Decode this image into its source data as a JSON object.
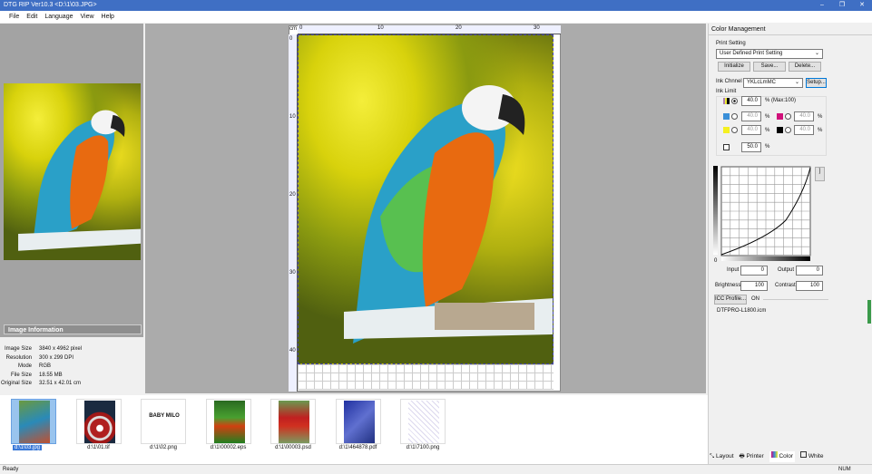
{
  "window": {
    "title": "DTG RIP Ver10.3  <D:\\1\\03.JPG>",
    "controls": [
      "–",
      "❐",
      "✕"
    ]
  },
  "menu": [
    "File",
    "Edit",
    "Language",
    "View",
    "Help"
  ],
  "image_info": {
    "title": "Image Information",
    "rows": [
      {
        "k": "Image Size",
        "v": "3840 x 4962 pixel"
      },
      {
        "k": "Resolution",
        "v": "300 x 299 DPI"
      },
      {
        "k": "Mode",
        "v": "RGB"
      },
      {
        "k": "File Size",
        "v": "18.55 MB"
      },
      {
        "k": "Original Size",
        "v": "32.51 x 42.01 cm"
      }
    ]
  },
  "ruler": {
    "unit": "cm",
    "top_ticks": [
      "0",
      "10",
      "20",
      "30"
    ],
    "left_ticks": [
      "0",
      "10",
      "20",
      "30",
      "40"
    ]
  },
  "color_mgmt": {
    "title": "Color Management",
    "print_setting_label": "Print Setting",
    "print_setting_value": "User Defined Print Setting",
    "initialize": "Initialize",
    "save": "Save...",
    "delete": "Delete...",
    "ink_channel_label": "Ink Chnnel",
    "ink_channel_value": "YKLcLmMC",
    "setup": "Setup...",
    "ink_limit_label": "Ink Limit",
    "all_value": "40.0",
    "max_text": "% (Max:100)",
    "cyan": "40.0",
    "magenta": "40.0",
    "yellow": "40.0",
    "black": "40.0",
    "white": "50.0",
    "pct": "%",
    "curve_origin": "0",
    "input_label": "Input",
    "input": "0",
    "output_label": "Output",
    "output": "0",
    "brightness_label": "Brightness",
    "brightness": "100",
    "contrast_label": "Contrast",
    "contrast": "100",
    "icc_button": "ICC Profile...",
    "icc_state": "ON",
    "icc_file": "DTFPRO-L1800.icm",
    "colors": {
      "cyan": "#3a8fd8",
      "magenta": "#d0107a",
      "yellow": "#f5f020",
      "black": "#000000"
    }
  },
  "tabs": [
    "Layout",
    "Printer",
    "Color",
    "White"
  ],
  "thumbnails": [
    {
      "label": "d:\\1\\03.jpg",
      "selected": true
    },
    {
      "label": "d:\\1\\01.tif"
    },
    {
      "label": "d:\\1\\02.png"
    },
    {
      "label": "d:\\1\\00002.eps"
    },
    {
      "label": "d:\\1\\00003.psd"
    },
    {
      "label": "d:\\1\\464878.pdf"
    },
    {
      "label": "d:\\1\\7100.png"
    }
  ],
  "baby_milo": "BABY MILO",
  "status": {
    "left": "Ready",
    "right": "NUM"
  }
}
